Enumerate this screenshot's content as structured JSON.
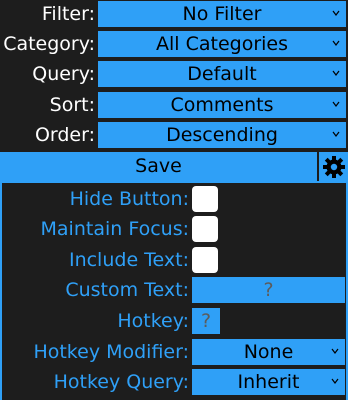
{
  "header": {
    "filter": {
      "label": "Filter:",
      "value": "No Filter"
    },
    "category": {
      "label": "Category:",
      "value": "All Categories"
    },
    "query": {
      "label": "Query:",
      "value": "Default"
    },
    "sort": {
      "label": "Sort:",
      "value": "Comments"
    },
    "order": {
      "label": "Order:",
      "value": "Descending"
    }
  },
  "save": {
    "label": "Save"
  },
  "settings": {
    "hide_button": {
      "label": "Hide Button:",
      "checked": false
    },
    "maintain_focus": {
      "label": "Maintain Focus:",
      "checked": false
    },
    "include_text": {
      "label": "Include Text:",
      "checked": false
    },
    "custom_text": {
      "label": "Custom Text:",
      "placeholder": "?"
    },
    "hotkey": {
      "label": "Hotkey:",
      "placeholder": "?"
    },
    "hotkey_modifier": {
      "label": "Hotkey Modifier:",
      "value": "None"
    },
    "hotkey_query": {
      "label": "Hotkey Query:",
      "value": "Inherit"
    }
  },
  "colors": {
    "accent": "#2fa0f7",
    "background": "#1d1d1d",
    "placeholder": "#5c5c5c"
  }
}
